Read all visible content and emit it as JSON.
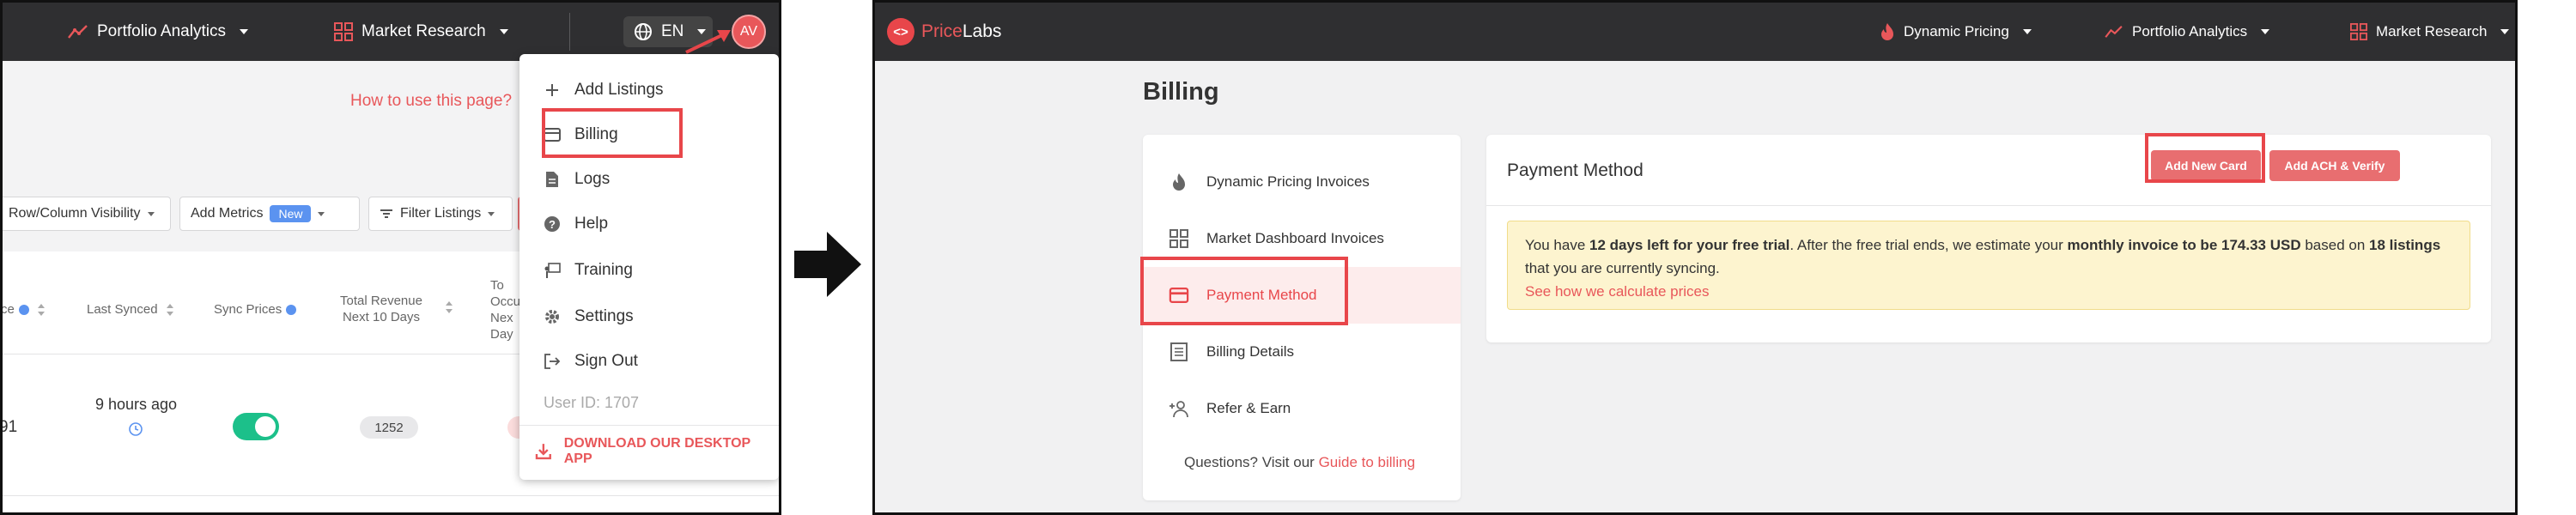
{
  "left_panel": {
    "nav": {
      "portfolio_analytics": "Portfolio Analytics",
      "market_research": "Market Research",
      "language": "EN",
      "avatar_initials": "AV"
    },
    "how_to_use": "How to use this page?",
    "toolbar": {
      "row_column_visibility": "Row/Column Visibility",
      "add_metrics": "Add Metrics",
      "new_badge": "New",
      "filter_listings": "Filter Listings"
    },
    "columns": {
      "price": "ce",
      "last_synced": "Last Synced",
      "sync_prices": "Sync Prices",
      "total_revenue_line1": "Total Revenue",
      "total_revenue_line2": "Next 10 Days",
      "occupancy_line1": "To",
      "occupancy_line2": "Occu",
      "occupancy_line3": "Nex",
      "occupancy_line4": "Day"
    },
    "row": {
      "price_fragment": "91",
      "last_synced": "9 hours ago",
      "sync_on": true,
      "total_revenue": "1252"
    },
    "menu": {
      "items": [
        {
          "label": "Add Listings",
          "icon": "plus-icon"
        },
        {
          "label": "Billing",
          "icon": "card-icon"
        },
        {
          "label": "Logs",
          "icon": "document-icon"
        },
        {
          "label": "Help",
          "icon": "question-icon"
        },
        {
          "label": "Training",
          "icon": "training-icon"
        },
        {
          "label": "Settings",
          "icon": "gear-icon"
        },
        {
          "label": "Sign Out",
          "icon": "sign-out-icon"
        }
      ],
      "user_id": "User ID: 1707",
      "download": "DOWNLOAD OUR DESKTOP APP"
    }
  },
  "right_panel": {
    "brand": {
      "part1": "Price",
      "part2": "Labs"
    },
    "nav": {
      "dynamic_pricing": "Dynamic Pricing",
      "portfolio_analytics": "Portfolio Analytics",
      "market_research": "Market Research"
    },
    "page_title": "Billing",
    "sidebar": {
      "items": [
        {
          "label": "Dynamic Pricing Invoices",
          "icon": "flame-icon"
        },
        {
          "label": "Market Dashboard Invoices",
          "icon": "grid-icon"
        },
        {
          "label": "Payment Method",
          "icon": "card-icon"
        },
        {
          "label": "Billing Details",
          "icon": "list-icon"
        },
        {
          "label": "Refer & Earn",
          "icon": "add-user-icon"
        }
      ],
      "help_prefix": "Questions? Visit our",
      "help_link": "Guide to billing"
    },
    "payment": {
      "title": "Payment Method",
      "add_card": "Add New Card",
      "add_ach": "Add ACH & Verify",
      "notice_1": "You have ",
      "notice_days": "12 days left for your free trial",
      "notice_2": ". After the free trial ends, we estimate your ",
      "notice_invoice": "monthly invoice to be 174.33 USD",
      "notice_3": " based on ",
      "notice_listings": "18 listings",
      "notice_4": "that you are currently syncing.",
      "notice_link": "See how we calculate prices"
    }
  },
  "colors": {
    "accent": "#e8464a",
    "topbar": "#2f2f31",
    "toggle_on": "#1cc08a",
    "notice_bg": "#fdf4cf"
  }
}
